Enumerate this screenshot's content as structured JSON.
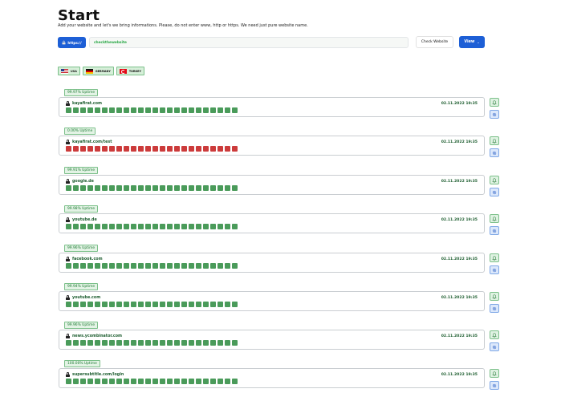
{
  "page": {
    "title": "Start",
    "subtitle": "Add your website and let's we bring informations. Please, do not enter www, http or https. We need just pure website name."
  },
  "url_bar": {
    "protocol_label": "https://",
    "input_value": "checkthewebsite"
  },
  "actions": {
    "check_label": "Check Website",
    "view_label": "View"
  },
  "flags": [
    {
      "label": "USA",
      "icon": "usa-flag-icon"
    },
    {
      "label": "GERMANY",
      "icon": "germany-flag-icon"
    },
    {
      "label": "TURKEY",
      "icon": "turkey-flag-icon"
    }
  ],
  "colors": {
    "primary": "#1d5fd6",
    "up": "#4a9b5a",
    "down": "#cc3b3b",
    "text_green": "#1e5e30"
  },
  "monitors": [
    {
      "uptime": "99.97% Uptime",
      "site": "kayafirat.com",
      "date": "02.11.2022 19:35",
      "status": "up"
    },
    {
      "uptime": "0.00% Uptime",
      "site": "kayafirat.com/test",
      "date": "02.11.2022 19:35",
      "status": "down"
    },
    {
      "uptime": "99.91% Uptime",
      "site": "google.de",
      "date": "02.11.2022 19:35",
      "status": "up"
    },
    {
      "uptime": "99.98% Uptime",
      "site": "youtube.de",
      "date": "02.11.2022 19:35",
      "status": "up"
    },
    {
      "uptime": "99.96% Uptime",
      "site": "facebook.com",
      "date": "02.11.2022 19:35",
      "status": "up"
    },
    {
      "uptime": "99.94% Uptime",
      "site": "youtube.com",
      "date": "02.11.2022 19:35",
      "status": "up"
    },
    {
      "uptime": "99.96% Uptime",
      "site": "news.ycombinator.com",
      "date": "02.11.2022 19:35",
      "status": "up"
    },
    {
      "uptime": "100.00% Uptime",
      "site": "supersubtitle.com/login",
      "date": "02.11.2022 19:35",
      "status": "up"
    }
  ],
  "bars_per_row": 24
}
